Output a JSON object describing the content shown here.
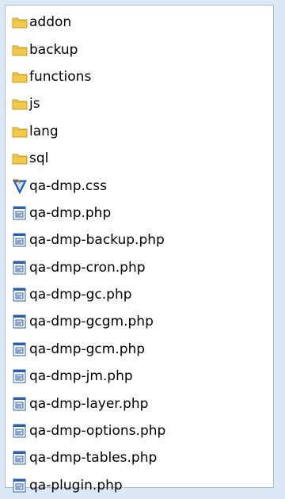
{
  "explorer": {
    "items": [
      {
        "label": "addon",
        "icon": "folder-icon"
      },
      {
        "label": "backup",
        "icon": "folder-icon"
      },
      {
        "label": "functions",
        "icon": "folder-icon"
      },
      {
        "label": "js",
        "icon": "folder-icon"
      },
      {
        "label": "lang",
        "icon": "folder-icon"
      },
      {
        "label": "sql",
        "icon": "folder-icon"
      },
      {
        "label": "qa-dmp.css",
        "icon": "css-file-icon"
      },
      {
        "label": "qa-dmp.php",
        "icon": "php-file-icon"
      },
      {
        "label": "qa-dmp-backup.php",
        "icon": "php-file-icon"
      },
      {
        "label": "qa-dmp-cron.php",
        "icon": "php-file-icon"
      },
      {
        "label": "qa-dmp-gc.php",
        "icon": "php-file-icon"
      },
      {
        "label": "qa-dmp-gcgm.php",
        "icon": "php-file-icon"
      },
      {
        "label": "qa-dmp-gcm.php",
        "icon": "php-file-icon"
      },
      {
        "label": "qa-dmp-jm.php",
        "icon": "php-file-icon"
      },
      {
        "label": "qa-dmp-layer.php",
        "icon": "php-file-icon"
      },
      {
        "label": "qa-dmp-options.php",
        "icon": "php-file-icon"
      },
      {
        "label": "qa-dmp-tables.php",
        "icon": "php-file-icon"
      },
      {
        "label": "qa-plugin.php",
        "icon": "php-file-icon"
      }
    ]
  },
  "colors": {
    "folder": "#f2c94c",
    "folder_edge": "#c99a1a",
    "css_blue": "#2f6fd0",
    "php_blue": "#2b5fa8"
  }
}
